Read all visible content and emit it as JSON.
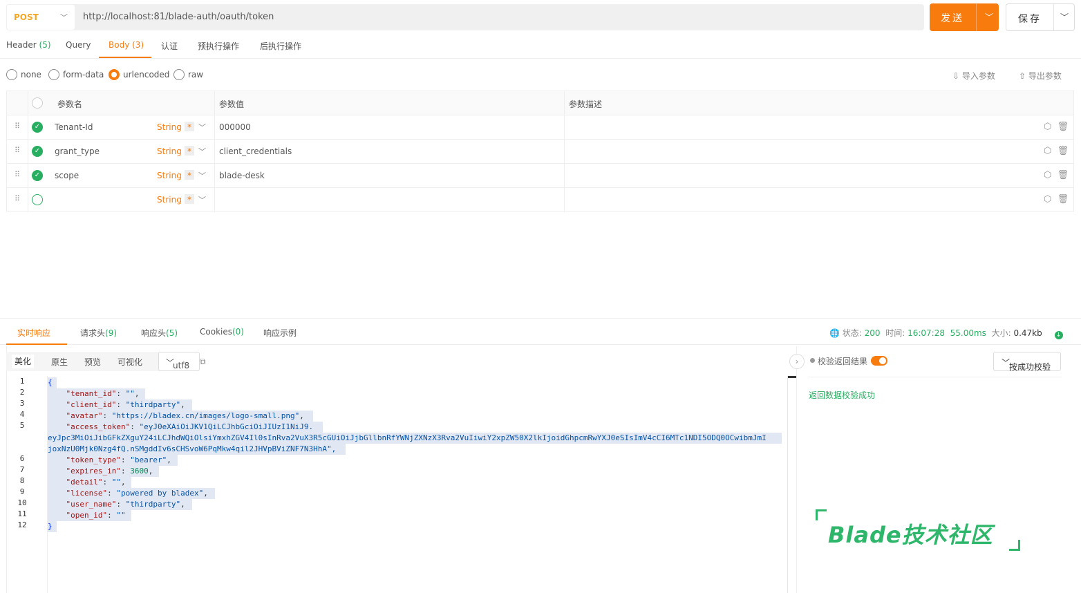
{
  "request": {
    "method": "POST",
    "url": "http://localhost:81/blade-auth/oauth/token",
    "send_label": "发送",
    "save_label": "保存"
  },
  "req_tabs": [
    {
      "label": "Header",
      "count": "(5)"
    },
    {
      "label": "Query",
      "count": ""
    },
    {
      "label": "Body",
      "count": "(3)"
    },
    {
      "label": "认证",
      "count": ""
    },
    {
      "label": "预执行操作",
      "count": ""
    },
    {
      "label": "后执行操作",
      "count": ""
    }
  ],
  "body_types": [
    "none",
    "form-data",
    "urlencoded",
    "raw"
  ],
  "body_type_selected": "urlencoded",
  "import_label": "导入参数",
  "export_label": "导出参数",
  "params": {
    "headers": [
      "参数名",
      "参数值",
      "参数描述"
    ],
    "rows": [
      {
        "name": "Tenant-Id",
        "type": "String",
        "required": "*",
        "value": "000000",
        "checked": true
      },
      {
        "name": "grant_type",
        "type": "String",
        "required": "*",
        "value": "client_credentials",
        "checked": true
      },
      {
        "name": "scope",
        "type": "String",
        "required": "*",
        "value": "blade-desk",
        "checked": true
      },
      {
        "name": "",
        "type": "String",
        "required": "*",
        "value": "",
        "checked": false
      }
    ]
  },
  "resp_tabs": [
    {
      "label": "实时响应",
      "count": ""
    },
    {
      "label": "请求头",
      "count": "(9)"
    },
    {
      "label": "响应头",
      "count": "(5)"
    },
    {
      "label": "Cookies",
      "count": "(0)"
    },
    {
      "label": "响应示例",
      "count": ""
    }
  ],
  "status": {
    "status_label": "状态:",
    "status_value": "200",
    "time_label": "时间:",
    "time_value": "16:07:28",
    "duration": "55.00ms",
    "size_label": "大小:",
    "size_value": "0.47kb"
  },
  "editor": {
    "views": [
      "美化",
      "原生",
      "预览",
      "可视化"
    ],
    "encoding": "utf8",
    "line_numbers": [
      "1",
      "2",
      "3",
      "4",
      "5",
      "",
      "",
      "6",
      "7",
      "8",
      "9",
      "10",
      "11",
      "12"
    ],
    "lines": [
      "{",
      "    \"tenant_id\": \"\",",
      "    \"client_id\": \"thirdparty\",",
      "    \"avatar\": \"https://bladex.cn/images/logo-small.png\",",
      "    \"access_token\": \"eyJ0eXAiOiJKV1QiLCJhbGciOiJIUzI1NiJ9.",
      "eyJpc3MiOiJibGFkZXguY24iLCJhdWQiOlsiYmxhZGV4Il0sInRva2VuX3R5cGUiOiJjbGllbnRfYWNjZXNzX3Rva2VuIiwiY2xpZW50X2lkIjoidGhpcmRwYXJ0eSIsImV4cCI6MTc1NDI5ODQ0OCwibmJmI",
      "joxNzU0Mjk0Nzg4fQ.nSMgddIv6sCHSvoW6PqMkw4qil2JHVpBViZNF7N3HhA\",",
      "    \"token_type\": \"bearer\",",
      "    \"expires_in\": 3600,",
      "    \"detail\": \"\",",
      "    \"license\": \"powered by bladex\",",
      "    \"user_name\": \"thirdparty\",",
      "    \"open_id\": \"\"",
      "}"
    ]
  },
  "validation": {
    "label": "校验返回结果",
    "mode": "按成功校验",
    "message": "返回数据校验成功"
  },
  "watermark": "Blade技术社区",
  "colors": {
    "accent": "#f77b0d",
    "success": "#27ae60"
  }
}
